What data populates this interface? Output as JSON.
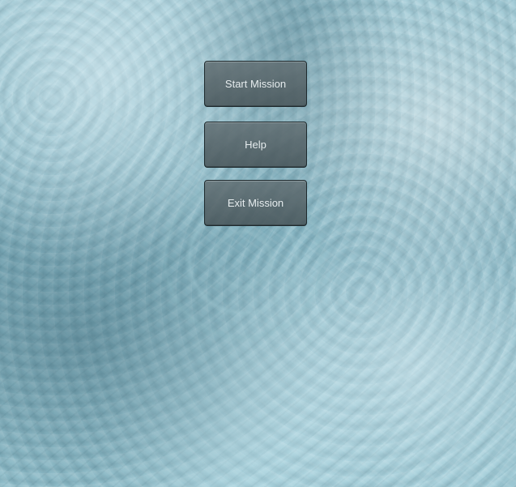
{
  "menu": {
    "start_label": "Start Mission",
    "help_label": "Help",
    "exit_label": "Exit Mission"
  },
  "colors": {
    "water": "#8fbfcc",
    "button_fill": "#5f6b6f",
    "button_border": "#1e2a2e",
    "button_text": "#e6ecee"
  }
}
